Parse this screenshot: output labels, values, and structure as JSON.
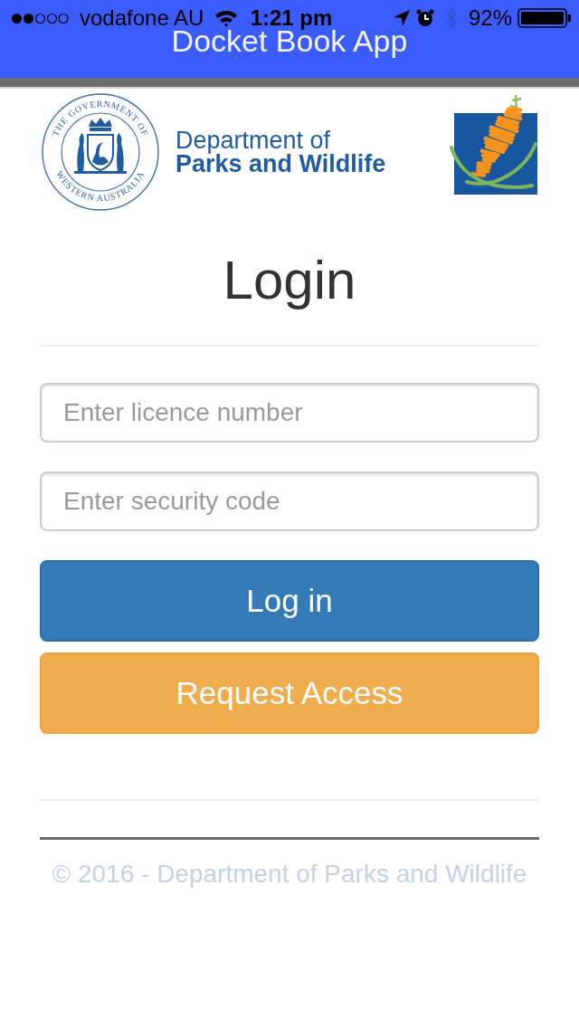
{
  "status_bar": {
    "carrier": "vodafone AU",
    "time": "1:21 pm",
    "battery": "92%"
  },
  "app_bar": {
    "title": "Docket Book App"
  },
  "logo": {
    "crest_ring_text": [
      "THE GOVERNMENT OF",
      "WESTERN AUSTRALIA"
    ],
    "line_1": "Department of",
    "line_2": "Parks and Wildlife"
  },
  "login": {
    "heading": "Login",
    "fields": [
      {
        "placeholder": "Enter licence number"
      },
      {
        "placeholder": "Enter security code"
      }
    ],
    "buttons": [
      {
        "label": "Log in",
        "kind": "primary"
      },
      {
        "label": "Request Access",
        "kind": "warning"
      }
    ]
  },
  "footer": {
    "text": "© 2016 - Department of Parks and Wildlife"
  }
}
